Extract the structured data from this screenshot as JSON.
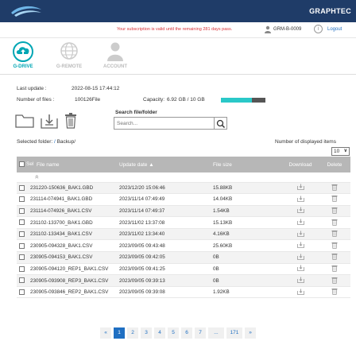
{
  "header": {
    "brand": "GRAPHTEC"
  },
  "subbar": {
    "message": "Your subscription is valid until the remaining 281 days pass.",
    "user_id": "GRM-B-0009",
    "info": "i",
    "logout": "Logout"
  },
  "nav": [
    {
      "label": "G-DRIVE",
      "icon": "cloud-upload-icon",
      "active": true
    },
    {
      "label": "G-REMOTE",
      "icon": "globe-icon",
      "active": false
    },
    {
      "label": "ACCOUNT",
      "icon": "user-icon",
      "active": false
    }
  ],
  "meta": {
    "last_update_label": "Last update :",
    "last_update_value": "2022-08-15 17:44:12",
    "num_files_label": "Number of files :",
    "num_files_value": "100126File",
    "capacity_label": "Capacity:",
    "capacity_value": "6.92 GB / 10 GB",
    "capacity_fraction": 0.69
  },
  "toolbar": {
    "folder_icon": "folder-icon",
    "download_icon": "download-icon",
    "trash_icon": "trash-icon"
  },
  "search": {
    "label": "Search file/folder",
    "placeholder": "Search..."
  },
  "selected_folder": {
    "label": "Selected folder:",
    "sep": " / ",
    "path": "Backup/"
  },
  "display": {
    "label": "Number of displayed items",
    "value": "10",
    "chevron": "∨"
  },
  "table": {
    "headers": {
      "select": "Sel",
      "file_name": "File name",
      "update_date": "Update date ▲",
      "file_size": "File size",
      "download": "Download",
      "delete": "Delete"
    },
    "up_glyph": "«",
    "rows": [
      {
        "name": "231220-150636_BAK1.GBD",
        "date": "2023/12/20 15:06:46",
        "size": "15.88KB"
      },
      {
        "name": "231114-074941_BAK1.GBD",
        "date": "2023/11/14 07:49:49",
        "size": "14.04KB"
      },
      {
        "name": "231114-074926_BAK1.CSV",
        "date": "2023/11/14 07:49:37",
        "size": "1.54KB"
      },
      {
        "name": "231102-133700_BAK1.GBD",
        "date": "2023/11/02 13:37:08",
        "size": "15.13KB"
      },
      {
        "name": "231102-133434_BAK1.CSV",
        "date": "2023/11/02 13:34:40",
        "size": "4.16KB"
      },
      {
        "name": "230905-094328_BAK1.CSV",
        "date": "2023/09/05 09:43:48",
        "size": "25.60KB"
      },
      {
        "name": "230905-094153_BAK1.CSV",
        "date": "2023/09/05 09:42:05",
        "size": "0B"
      },
      {
        "name": "230905-094120_REP1_BAK1.CSV",
        "date": "2023/09/05 09:41:25",
        "size": "0B"
      },
      {
        "name": "230905-093908_REP3_BAK1.CSV",
        "date": "2023/09/05 09:39:13",
        "size": "0B"
      },
      {
        "name": "230905-093846_REP2_BAK1.CSV",
        "date": "2023/09/05 09:39:08",
        "size": "1.92KB"
      }
    ]
  },
  "pagination": {
    "prev": "«",
    "pages": [
      "1",
      "2",
      "3",
      "4",
      "5",
      "6",
      "7",
      "...",
      "171"
    ],
    "next": "»",
    "active": "1"
  },
  "colors": {
    "header": "#1f3c68",
    "accent": "#00a6b4",
    "capacity": "#2ac8c8",
    "alert": "#d9343a",
    "link": "#1f6fc2"
  }
}
